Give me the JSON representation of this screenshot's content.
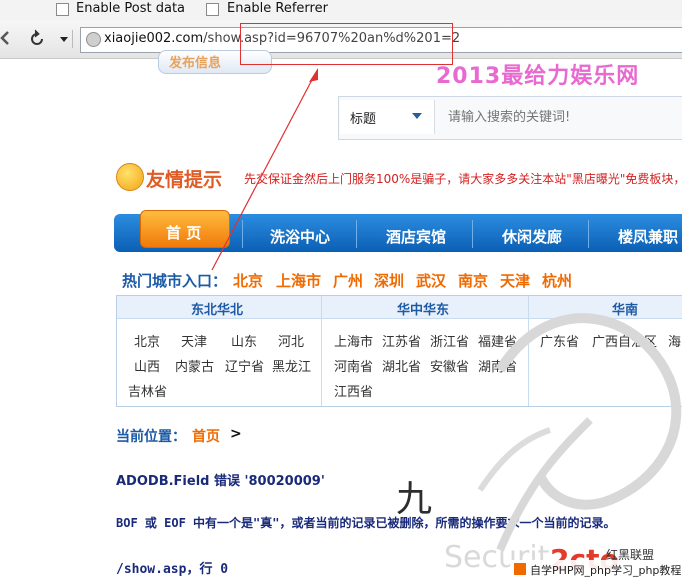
{
  "addon_bar": {
    "post_data_label": "Enable Post data",
    "referrer_label": "Enable Referrer"
  },
  "toolbar": {
    "back_icon": "back-arrow-icon",
    "reload_icon": "reload-icon",
    "url_host": "xiaojie002.com",
    "url_rest": "/show.asp?id=96707%20an%d%201=2"
  },
  "site": {
    "banner_title": "2013最给力娱乐网",
    "ribbon_text": "发布信息",
    "search": {
      "select_label": "标题",
      "placeholder": "请输入搜索的关键词!"
    },
    "notice": {
      "title": "友情提示",
      "text": "先交保证金然后上门服务100%是骗子，请大家多多关注本站\"黑店曝光\"免费板块，"
    },
    "nav": [
      "首 页",
      "洗浴中心",
      "酒店宾馆",
      "休闲发廊",
      "楼凤兼职"
    ],
    "hot_cities_label": "热门城市入口：",
    "hot_cities": [
      "北京",
      "上海市",
      "广州",
      "深圳",
      "武汉",
      "南京",
      "天津",
      "杭州"
    ],
    "regions": [
      {
        "title": "东北华北",
        "items": [
          "北京",
          "天津",
          "山东",
          "河北",
          "山西",
          "内蒙古",
          "辽宁省",
          "黑龙江",
          "吉林省"
        ]
      },
      {
        "title": "华中华东",
        "items": [
          "上海市",
          "江苏省",
          "浙江省",
          "福建省",
          "河南省",
          "湖北省",
          "安徽省",
          "湖南省",
          "江西省"
        ]
      },
      {
        "title": "华南",
        "items": [
          "广东省",
          "广西自治区",
          "海"
        ]
      }
    ],
    "location": {
      "label": "当前位置：",
      "home": "首页",
      "arrow": ">"
    },
    "error": {
      "title": "ADODB.Field 错误 '80020009'",
      "description": "BOF 或 EOF 中有一个是\"真\"，或者当前的记录已被删除，所需的操作要求一个当前的记录。",
      "location": "/show.asp，行 0"
    }
  },
  "watermark": {
    "security": "Securit",
    "brand": "2cto",
    "brand_sub": "红黑联盟",
    "jiu": "九",
    "footer": "自学PHP网_php学习_php教程"
  }
}
